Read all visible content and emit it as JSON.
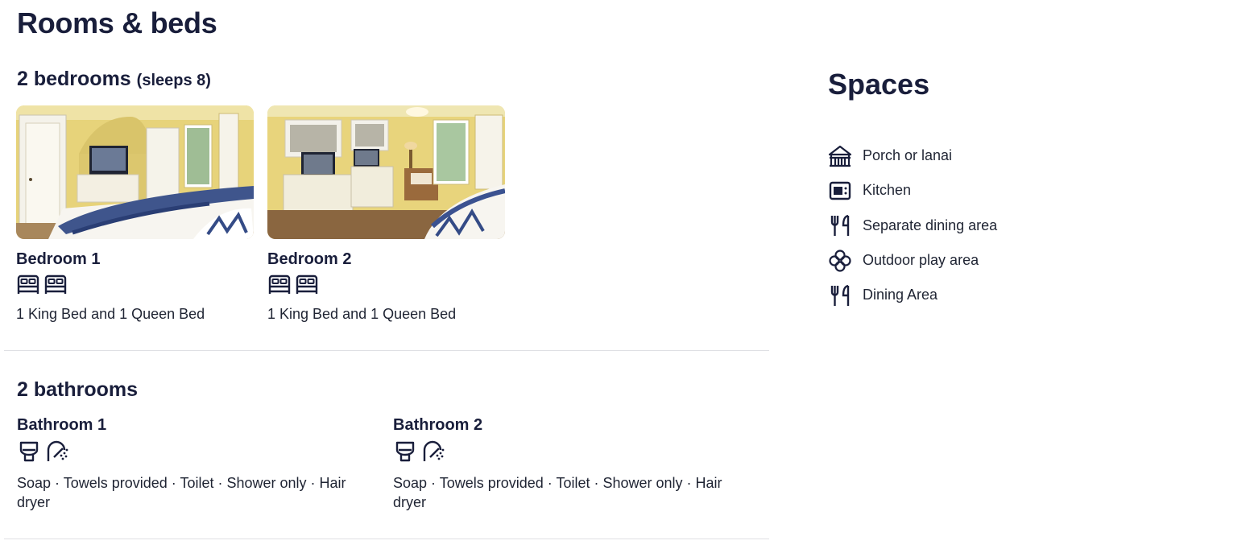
{
  "page_title": "Rooms & beds",
  "bedrooms": {
    "heading": "2 bedrooms",
    "sleeps": "(sleeps 8)",
    "rooms": [
      {
        "name": "Bedroom 1",
        "beds": "1 King Bed and 1 Queen Bed",
        "icons": [
          "bed-icon",
          "bed-icon"
        ]
      },
      {
        "name": "Bedroom 2",
        "beds": "1 King Bed and 1 Queen Bed",
        "icons": [
          "bed-icon",
          "bed-icon"
        ]
      }
    ]
  },
  "bathrooms": {
    "heading": "2 bathrooms",
    "items": [
      {
        "name": "Bathroom 1",
        "amenities": "Soap · Towels provided · Toilet · Shower only · Hair dryer",
        "icons": [
          "toilet-icon",
          "shower-icon"
        ]
      },
      {
        "name": "Bathroom 2",
        "amenities": "Soap · Towels provided · Toilet · Shower only · Hair dryer",
        "icons": [
          "toilet-icon",
          "shower-icon"
        ]
      }
    ]
  },
  "spaces": {
    "title": "Spaces",
    "items": [
      {
        "label": "Porch or lanai",
        "icon": "porch-icon"
      },
      {
        "label": "Kitchen",
        "icon": "kitchen-icon"
      },
      {
        "label": "Separate dining area",
        "icon": "dining-icon"
      },
      {
        "label": "Outdoor play area",
        "icon": "play-area-icon"
      },
      {
        "label": "Dining Area",
        "icon": "dining-icon"
      }
    ]
  },
  "colors": {
    "text": "#191e3b",
    "divider": "#dfe0e4",
    "wall": "#e8d67a"
  }
}
